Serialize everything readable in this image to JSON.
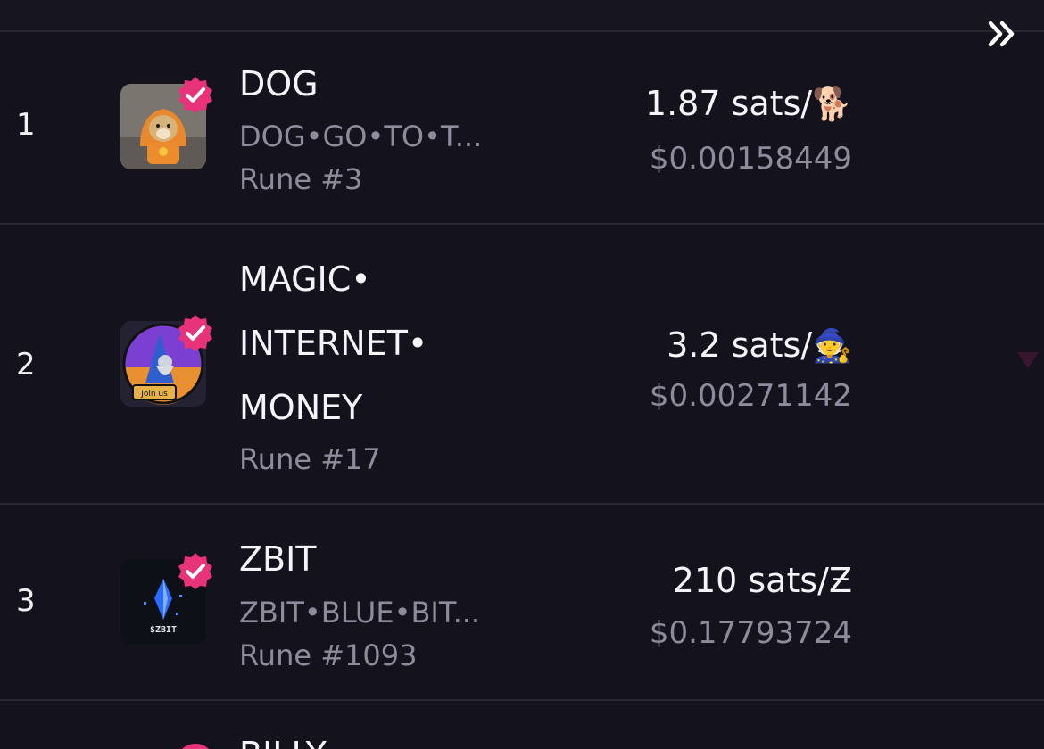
{
  "colors": {
    "background": "#14121c",
    "divider": "#2a2735",
    "verified_badge": "#e8337a",
    "muted_text": "#8f8b9c"
  },
  "icons": {
    "expand": "double-chevron-right-icon",
    "verified": "verified-check-badge-icon"
  },
  "rows": [
    {
      "rank": "1",
      "name": "DOG",
      "spaced_name": "DOG•GO•TO•T...",
      "rune_id": "Rune #3",
      "price": "1.87 sats/",
      "symbol": "🐕",
      "usd": "$0.00158449"
    },
    {
      "rank": "2",
      "name_line1": "MAGIC•",
      "name_line2": "INTERNET•",
      "name_line3": "MONEY",
      "rune_id": "Rune #17",
      "price": "3.2 sats/",
      "symbol": "🧙",
      "usd": "$0.00271142",
      "logo_text": "Join us"
    },
    {
      "rank": "3",
      "name": "ZBIT",
      "spaced_name": "ZBIT•BLUE•BIT...",
      "rune_id": "Rune #1093",
      "price": "210 sats/Ƶ",
      "usd": "$0.17793724",
      "logo_text": "$ZBIT"
    },
    {
      "name_partial": "BILLY"
    }
  ]
}
